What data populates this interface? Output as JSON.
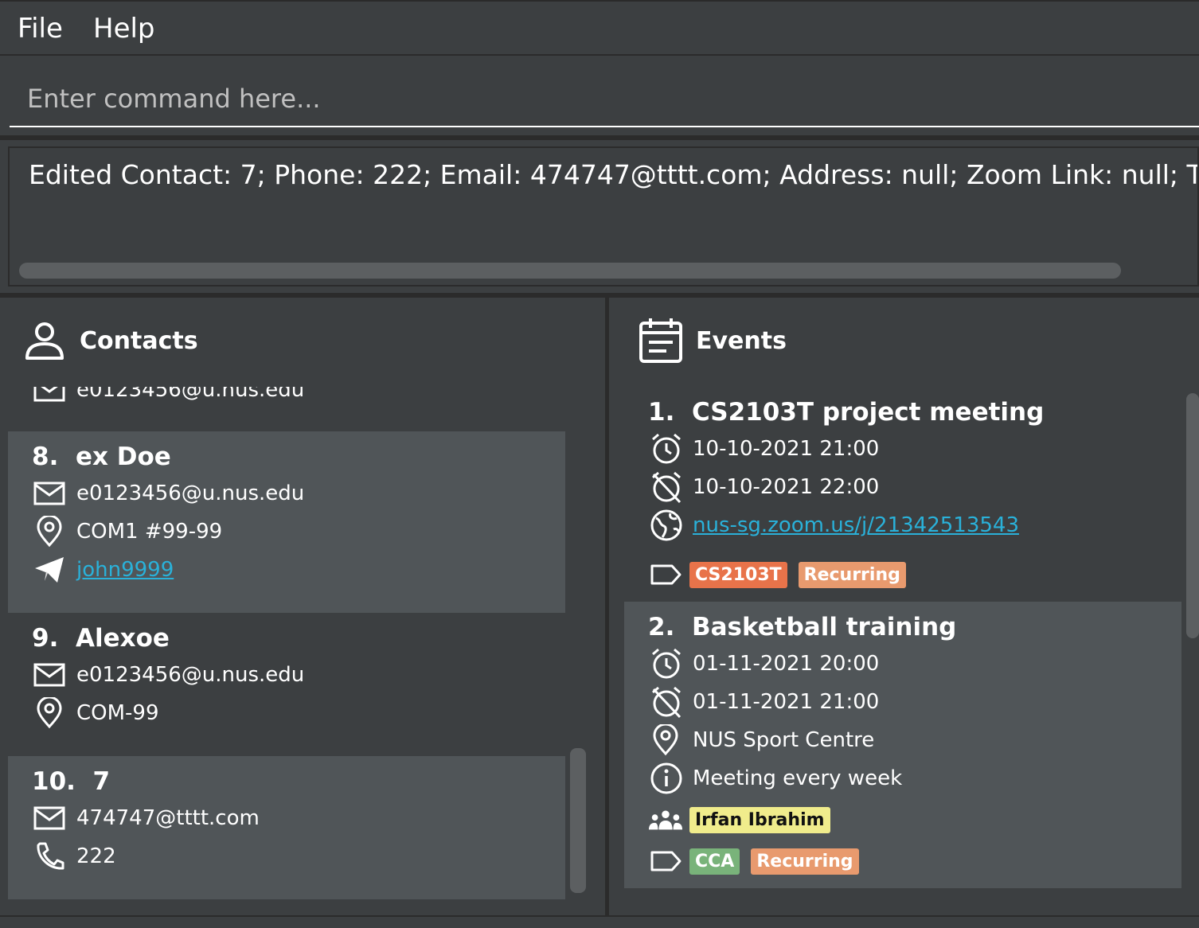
{
  "menu": {
    "file": "File",
    "help": "Help"
  },
  "command": {
    "placeholder": "Enter command here..."
  },
  "result": {
    "text": "Edited Contact: 7; Phone: 222; Email: 474747@tttt.com; Address: null; Zoom Link: null; Telegram"
  },
  "contacts": {
    "title": "Contacts",
    "partial_email": "e0123456@u.nus.edu",
    "items": [
      {
        "index": "8.",
        "name": "ex Doe",
        "email": "e0123456@u.nus.edu",
        "address": "COM1 #99-99",
        "telegram": "john9999"
      },
      {
        "index": "9.",
        "name": "Alexoe",
        "email": "e0123456@u.nus.edu",
        "address": "COM-99"
      },
      {
        "index": "10.",
        "name": "7",
        "email": "474747@tttt.com",
        "phone": "222"
      }
    ]
  },
  "events": {
    "title": "Events",
    "items": [
      {
        "index": "1.",
        "name": "CS2103T project meeting",
        "start": "10-10-2021 21:00",
        "end": "10-10-2021 22:00",
        "zoom": "nus-sg.zoom.us/j/21342513543",
        "tags": [
          "CS2103T",
          "Recurring"
        ]
      },
      {
        "index": "2.",
        "name": "Basketball training",
        "start": "01-11-2021 20:00",
        "end": "01-11-2021 21:00",
        "address": "NUS Sport Centre",
        "description": "Meeting every week",
        "participants": [
          "Irfan Ibrahim"
        ],
        "tags": [
          "CCA",
          "Recurring"
        ]
      }
    ]
  },
  "colors": {
    "tag_cs2103t": "#e8734a",
    "tag_recurring": "#e89a6e",
    "tag_cca": "#79b37a",
    "participant": "#f0ec8c",
    "link": "#2ab1d9"
  }
}
